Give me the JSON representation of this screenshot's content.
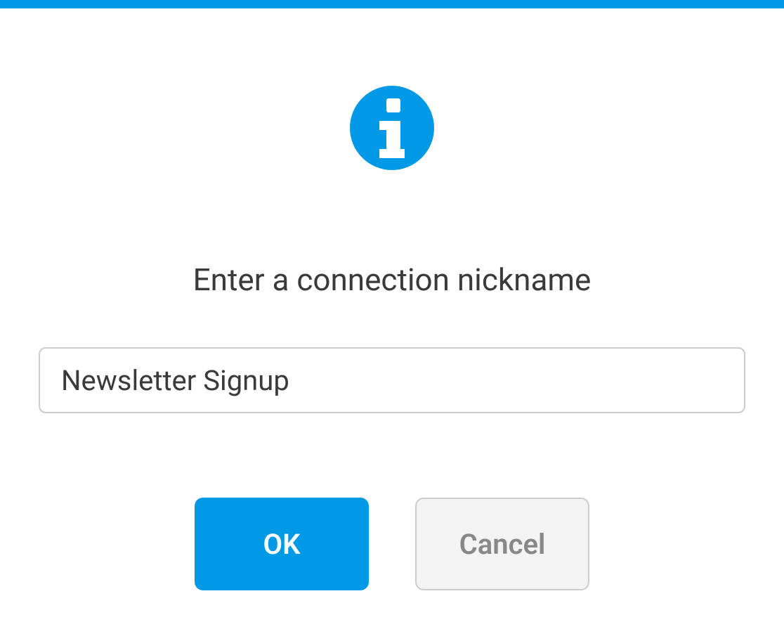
{
  "dialog": {
    "title": "Enter a connection nickname",
    "input": {
      "value": "Newsletter Signup"
    },
    "buttons": {
      "ok": "OK",
      "cancel": "Cancel"
    }
  },
  "colors": {
    "accent": "#0099e5"
  }
}
